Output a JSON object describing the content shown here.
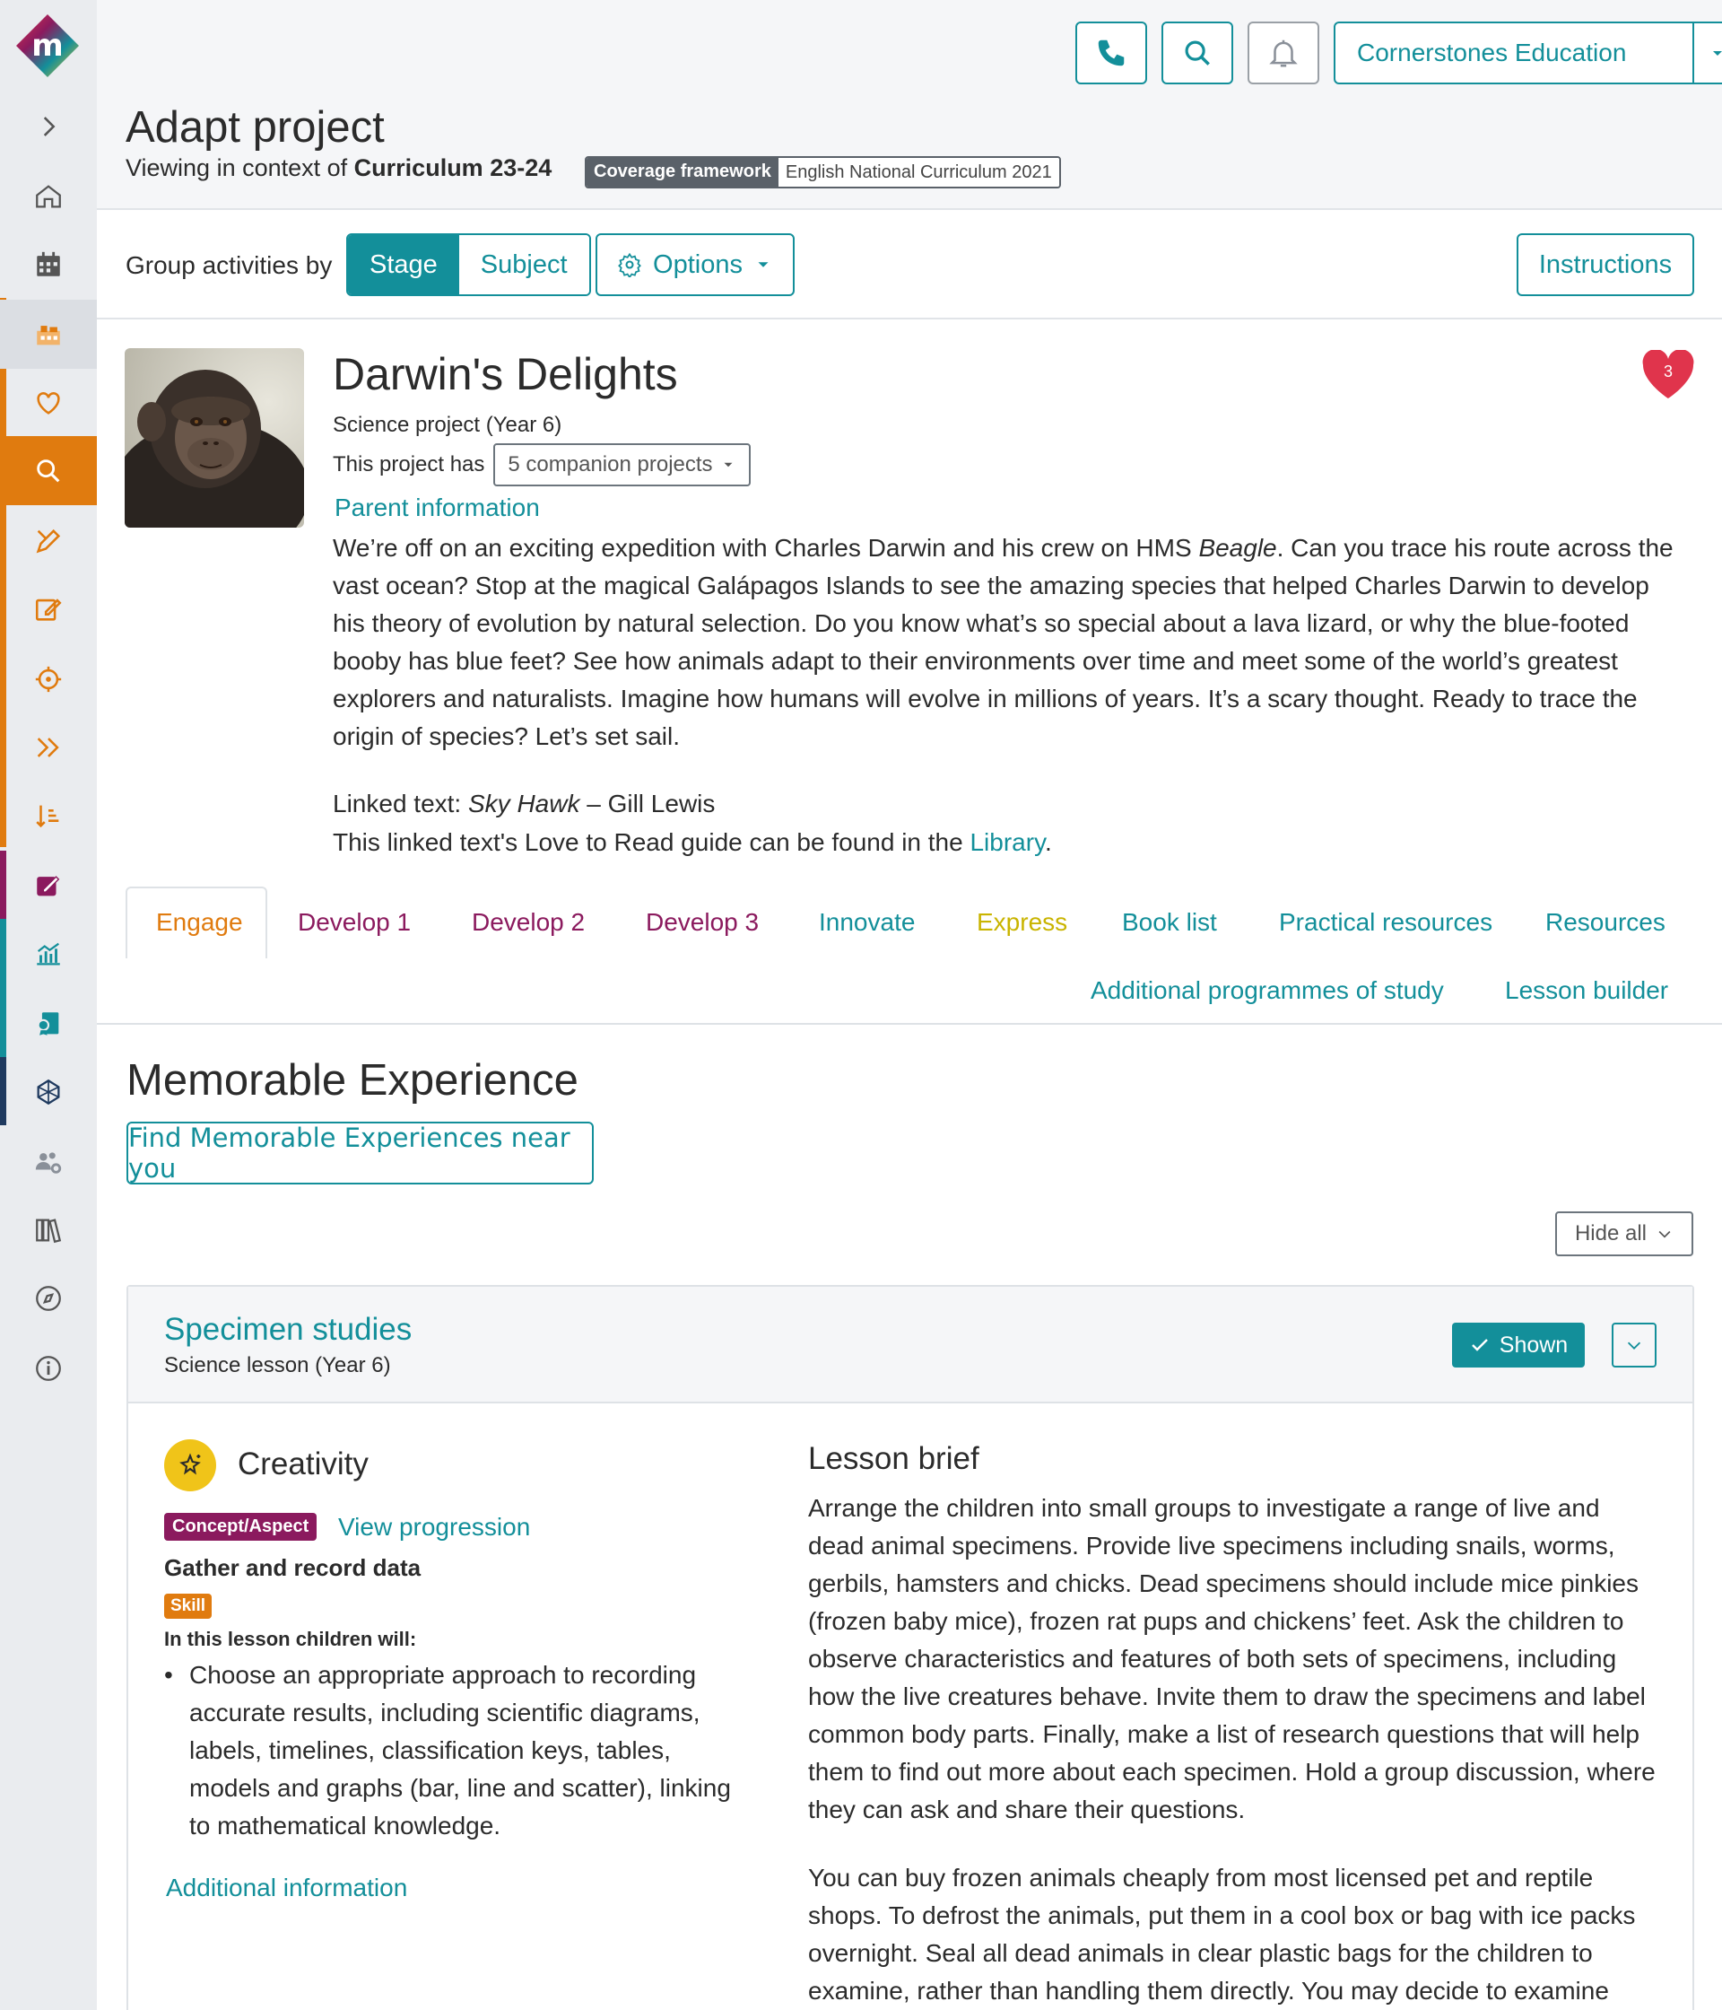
{
  "colors": {
    "teal": "#138f9a",
    "orange": "#e07b0f",
    "plum": "#8b1a5e",
    "yellow": "#c9b400",
    "heart": "#e0344c"
  },
  "header": {
    "org_name": "Cornerstones Education",
    "page_title": "Adapt project",
    "context_prefix": "Viewing in context of",
    "context_name": "Curriculum 23-24",
    "coverage_key": "Coverage framework",
    "coverage_value": "English National Curriculum 2021",
    "icons": [
      "phone-icon",
      "search-icon",
      "bell-icon"
    ]
  },
  "groupbar": {
    "label": "Group activities by",
    "stage": "Stage",
    "subject": "Subject",
    "options": "Options",
    "instructions": "Instructions"
  },
  "project": {
    "title": "Darwin's Delights",
    "subtitle": "Science project (Year 6)",
    "has_label": "This project has",
    "companion": "5 companion projects",
    "parent_info": "Parent information",
    "favourites": "3",
    "desc_a": "We’re off on an exciting expedition with Charles Darwin and his crew on HMS ",
    "desc_ship": "Beagle",
    "desc_b": ". Can you trace his route across the vast ocean? Stop at the magical Galápagos Islands to see the amazing species that helped Charles Darwin to develop his theory of evolution by natural selection. Do you know what’s so special about a lava lizard, or why the blue-footed booby has blue feet? See how animals adapt to their environments over time and meet some of the world’s greatest explorers and naturalists. Imagine how humans will evolve in millions of years. It’s a scary thought. Ready to trace the origin of species? Let’s set sail.",
    "linked_prefix": "Linked text: ",
    "linked_title": "Sky Hawk",
    "linked_author": " – Gill Lewis",
    "guide_prefix": "This linked text's Love to Read guide can be found in the ",
    "guide_link": "Library",
    "guide_suffix": "."
  },
  "tabs": [
    {
      "label": "Engage"
    },
    {
      "label": "Develop 1"
    },
    {
      "label": "Develop 2"
    },
    {
      "label": "Develop 3"
    },
    {
      "label": "Innovate"
    },
    {
      "label": "Express"
    },
    {
      "label": "Book list"
    },
    {
      "label": "Practical resources"
    },
    {
      "label": "Resources"
    },
    {
      "label": "Additional programmes of study"
    },
    {
      "label": "Lesson builder"
    }
  ],
  "memorable": {
    "title": "Memorable Experience",
    "find_button": "Find Memorable Experiences near you",
    "hide_all": "Hide all"
  },
  "lesson": {
    "title": "Specimen studies",
    "subtitle": "Science lesson (Year 6)",
    "shown": "Shown",
    "concept_name": "Creativity",
    "concept_badge": "Concept/Aspect",
    "view_progression": "View progression",
    "skill_name": "Gather and record data",
    "skill_badge": "Skill",
    "will_label": "In this lesson children will:",
    "outcome": "Choose an appropriate approach to recording accurate results, including scientific diagrams, labels, timelines, classification keys, tables, models and graphs (bar, line and scatter), linking to mathematical knowledge.",
    "additional_info": "Additional information",
    "brief_title": "Lesson brief",
    "brief_p1": "Arrange the children into small groups to investigate a range of live and dead animal specimens. Provide live specimens including snails, worms, gerbils, hamsters and chicks. Dead specimens should include mice pinkies (frozen baby mice), frozen rat pups and chickens’ feet. Ask the children to observe characteristics and features of both sets of specimens, including how the live creatures behave. Invite them to draw the specimens and label common body parts. Finally, make a list of research questions that will help them to find out more about each specimen. Hold a group discussion, where they can ask and share their questions.",
    "brief_p2": "You can buy frozen animals cheaply from most licensed pet and reptile shops. To defrost the animals, put them in a cool box or bag with ice packs overnight. Seal all dead animals in clear plastic bags for the children to examine, rather than handling them directly. You may decide to examine"
  },
  "sidebar": {
    "icons": [
      "logo-icon",
      "expand-chevron-icon",
      "home-icon",
      "calendar-icon",
      "projects-icon",
      "favourites-icon",
      "search-icon",
      "design-icon",
      "edit-icon",
      "target-icon",
      "fast-forward-icon",
      "sort-icon",
      "assessment-icon",
      "analytics-icon",
      "badge-icon",
      "network-icon",
      "users-settings-icon",
      "library-icon",
      "compass-icon",
      "info-icon"
    ]
  }
}
